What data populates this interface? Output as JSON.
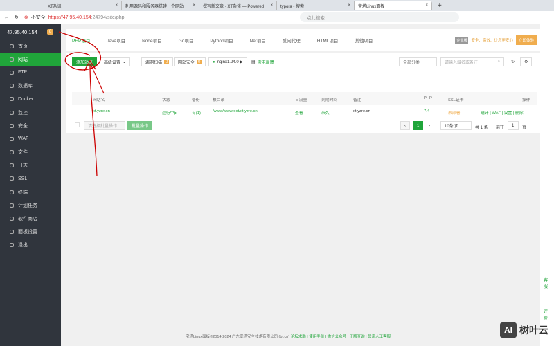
{
  "browser": {
    "tabs": [
      "XT杂谈",
      "利用源码和服务器搭建一个网站",
      "撰写新文章 · XT杂谈 — Powered",
      "typora - 搜索",
      "宝塔Linux面板"
    ],
    "security": "不安全",
    "url_host": "https://47.95.40.154",
    "url_rest": ":24794/site/php",
    "search_placeholder": "点此搜索"
  },
  "sidebar": {
    "ip": "47.95.40.154",
    "badge": "0",
    "items": [
      "首页",
      "网站",
      "FTP",
      "数据库",
      "Docker",
      "监控",
      "安全",
      "WAF",
      "文件",
      "日志",
      "SSL",
      "终端",
      "计划任务",
      "软件商店",
      "面板设置",
      "退出"
    ]
  },
  "project_tabs": [
    "PHP项目",
    "Java项目",
    "Node项目",
    "Go项目",
    "Python项目",
    "Net项目",
    "反向代理",
    "HTML项目",
    "其他项目"
  ],
  "promo": {
    "tag": "企业版",
    "text": "安全、高效、让您更安心",
    "button": "立即体验"
  },
  "toolbar": {
    "add": "添加站点",
    "advanced": "高级设置",
    "vuln": "漏洞扫描",
    "vuln_count": "0",
    "security": "网站安全",
    "security_count": "0",
    "nginx": "nginx1.24.0 ▶",
    "feedback": "需求反馈",
    "category": "全部分类",
    "search_placeholder": "请输入域名或备注"
  },
  "table": {
    "headers": [
      "网站名",
      "状态",
      "备份",
      "根目录",
      "日流量",
      "到期时间",
      "备注",
      "PHP",
      "SSL证书",
      "操作"
    ],
    "row": {
      "name": "xt.yzre.cn",
      "status": "运行中▶",
      "backup": "有(1)",
      "root": "/www/wwwroot/xt.yzre.cn",
      "traffic": "查看",
      "expire": "永久",
      "note": "xt.yzre.cn",
      "php": "7.4",
      "ssl": "未部署",
      "ops": "统计 | WAF | 设置 | 删除"
    }
  },
  "batch": {
    "select": "请选择批量操作",
    "button": "批量操作"
  },
  "pagination": {
    "page": "1",
    "per_page": "10条/页",
    "total": "共 1 条",
    "goto": "前往",
    "goto_value": "1",
    "page_unit": "页"
  },
  "footer": {
    "copyright": "宝塔Linux面板©2014-2024 广东堡塔安全技术有限公司 (bt.cn)",
    "links": "论坛求助 | 使用手册 | 微信公众号 | 正版查询 | 联系人工客服"
  },
  "float": {
    "service": "客服",
    "review": "评价"
  },
  "watermark": "树叶云"
}
